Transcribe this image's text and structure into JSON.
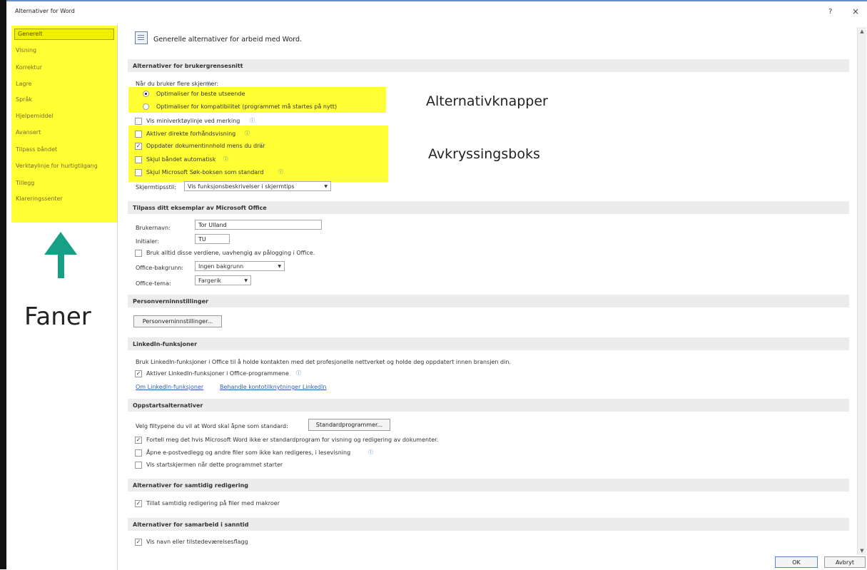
{
  "window": {
    "title": "Alternativer for Word",
    "help": "?",
    "close": "×"
  },
  "sidebar": {
    "items": [
      {
        "label": "Generelt",
        "selected": true
      },
      {
        "label": "Visning"
      },
      {
        "label": "Korrektur"
      },
      {
        "label": "Lagre"
      },
      {
        "label": "Språk"
      },
      {
        "label": "Hjelpemiddel"
      },
      {
        "label": "Avansert"
      },
      {
        "label": "Tilpass båndet"
      },
      {
        "label": "Verktøylinje for hurtigtilgang"
      },
      {
        "label": "Tillegg"
      },
      {
        "label": "Klareringssenter"
      }
    ]
  },
  "annotations": {
    "faner": "Faner",
    "alternativknapper": "Alternativknapper",
    "avkryssingsboks": "Avkryssingsboks",
    "highlight_color": "#ffff33",
    "arrow_color": "#17a085"
  },
  "header": {
    "text": "Generelle alternativer for arbeid med Word."
  },
  "ui_section": {
    "title": "Alternativer for brukergrensesnitt",
    "multi_screen_label": "Når du bruker flere skjermer:",
    "radios": [
      {
        "label": "Optimaliser for beste utseende",
        "checked": true
      },
      {
        "label": "Optimaliser for kompatibilitet (programmet må startes på nytt)",
        "checked": false
      }
    ],
    "checkboxes": [
      {
        "label": "Vis miniverktøylinje ved merking",
        "checked": false
      },
      {
        "label": "Aktiver direkte forhåndsvisning",
        "checked": false
      },
      {
        "label": "Oppdater dokumentinnhold mens du drar",
        "checked": true
      },
      {
        "label": "Skjul båndet automatisk",
        "checked": false
      },
      {
        "label": "Skjul Microsoft Søk-boksen som standard",
        "checked": false
      }
    ],
    "screentip_label": "Skjermtipsstil:",
    "screentip_value": "Vis funksjonsbeskrivelser i skjermtips"
  },
  "office_section": {
    "title": "Tilpass ditt eksemplar av Microsoft Office",
    "username_label": "Brukernavn:",
    "username_value": "Tor Ulland",
    "initials_label": "Initialer:",
    "initials_value": "TU",
    "always_use_label": "Bruk alltid disse verdiene, uavhengig av pålogging i Office.",
    "background_label": "Office-bakgrunn:",
    "background_value": "Ingen bakgrunn",
    "theme_label": "Office-tema:",
    "theme_value": "Fargerik"
  },
  "privacy_section": {
    "title": "Personverninnstillinger",
    "button": "Personverninnstillinger..."
  },
  "linkedin_section": {
    "title": "LinkedIn-funksjoner",
    "description": "Bruk LinkedIn-funksjoner i Office til å holde kontakten med det profesjonelle nettverket og holde deg oppdatert innen bransjen din.",
    "enable_label": "Aktiver LinkedIn-funksjoner i Office-programmene",
    "link1": "Om LinkedIn-funksjoner",
    "link2": "Behandle kontotilknytninger LinkedIn"
  },
  "startup_section": {
    "title": "Oppstartsalternativer",
    "filetypes_label": "Velg filtypene du vil at Word skal åpne som standard:",
    "default_button": "Standardprogrammer...",
    "checkboxes": [
      {
        "label": "Fortell meg det hvis Microsoft Word ikke er standardprogram for visning og redigering av dokumenter.",
        "checked": true
      },
      {
        "label": "Åpne e-postvedlegg og andre filer som ikke kan redigeres, i lesevisning",
        "checked": false
      },
      {
        "label": "Vis startskjermen når dette programmet starter",
        "checked": false
      }
    ]
  },
  "coauth_section": {
    "title": "Alternativer for samtidig redigering",
    "checkbox": "Tillat samtidig redigering på filer med makroer"
  },
  "realtime_section": {
    "title": "Alternativer for samarbeid i sanntid",
    "checkbox": "Vis navn eller tilstedeværelsesflagg"
  },
  "footer": {
    "ok": "OK",
    "cancel": "Avbryt"
  }
}
